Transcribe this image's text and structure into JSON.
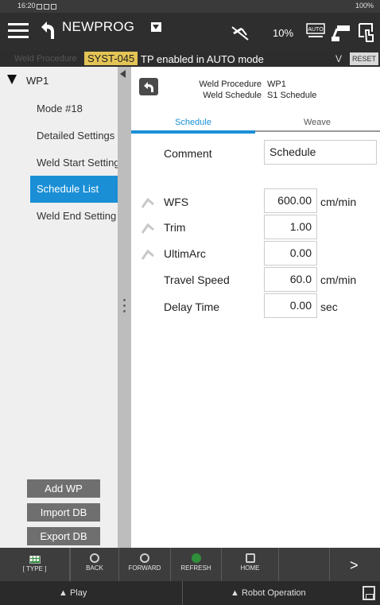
{
  "status_bar": {
    "time": "16:20",
    "battery": "100%"
  },
  "header": {
    "program_name": "NEWPROG",
    "override": "10%",
    "mode_badge": "AUTO"
  },
  "alarm": {
    "ghost_label": "Weld Procedure",
    "program_code": "SYST-045",
    "message": "TP enabled in AUTO mode",
    "chevron": "V",
    "reset_label": "RESET"
  },
  "tree": {
    "root": "WP1",
    "items": [
      {
        "label": "Mode #18"
      },
      {
        "label": "Detailed Settings"
      },
      {
        "label": "Weld Start Setting"
      },
      {
        "label": "Schedule List"
      },
      {
        "label": "Weld End Setting"
      }
    ],
    "buttons": {
      "add": "Add WP",
      "import": "Import DB",
      "export": "Export DB"
    }
  },
  "detail": {
    "procedure_label": "Weld Procedure",
    "procedure_value": "WP1",
    "schedule_label": "Weld Schedule",
    "schedule_value": "S1 Schedule"
  },
  "tabs": {
    "schedule": "Schedule",
    "weave": "Weave"
  },
  "fields": {
    "comment": {
      "label": "Comment",
      "value": "Schedule"
    },
    "wfs": {
      "label": "WFS",
      "value": "600.00",
      "unit": "cm/min"
    },
    "trim": {
      "label": "Trim",
      "value": "1.00"
    },
    "ultimarc": {
      "label": "UltimArc",
      "value": "0.00"
    },
    "travel_speed": {
      "label": "Travel Speed",
      "value": "60.0",
      "unit": "cm/min"
    },
    "delay_time": {
      "label": "Delay Time",
      "value": "0.00",
      "unit": "sec"
    }
  },
  "toolbar": {
    "type": "[ TYPE ]",
    "back": "BACK",
    "forward": "FORWARD",
    "refresh": "REFRESH",
    "home": "HOME",
    "next": ">"
  },
  "footer": {
    "play": "▲ Play",
    "robot_operation": "▲ Robot Operation"
  },
  "colors": {
    "accent": "#1a8fd6",
    "program_code_bg": "#e3c455",
    "header_bg": "#2e2e2e"
  }
}
